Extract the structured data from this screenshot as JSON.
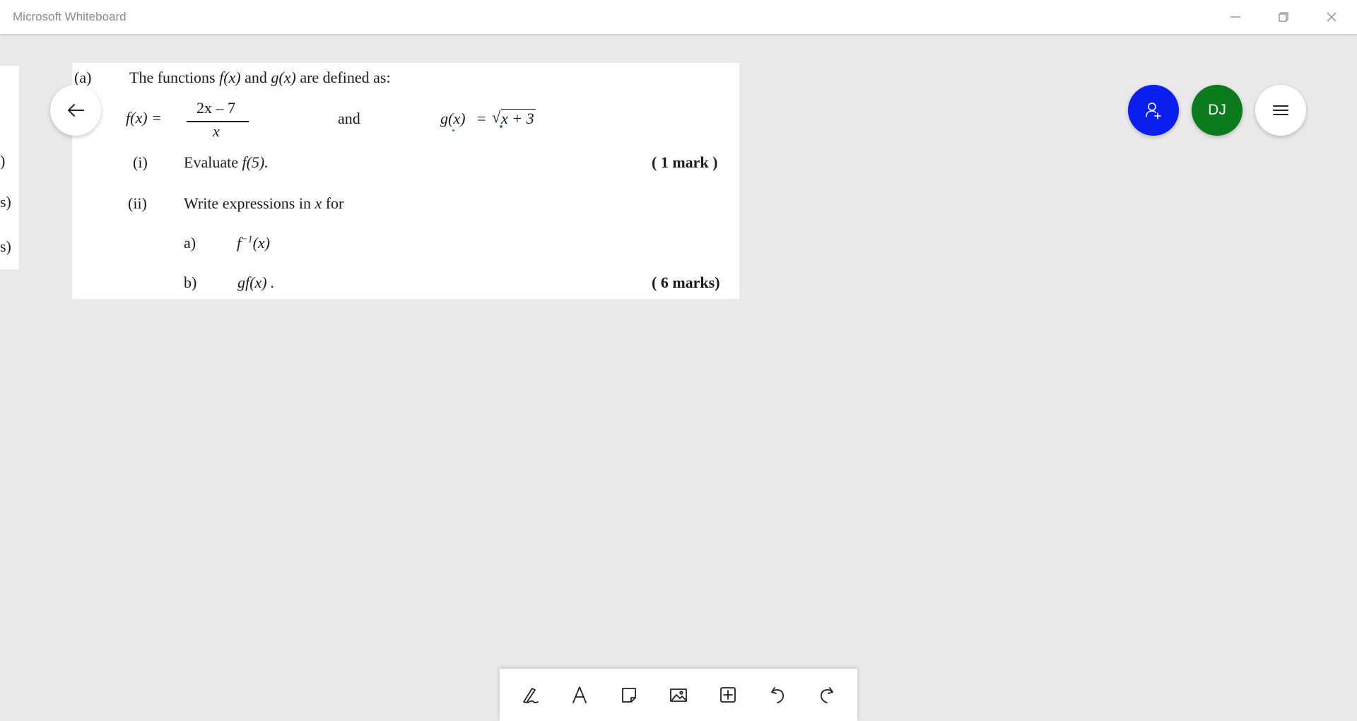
{
  "window": {
    "title": "Microsoft Whiteboard",
    "controls": [
      "minimize-icon",
      "restore-icon",
      "close-icon"
    ]
  },
  "left_card": {
    "fragments": [
      ")",
      "s)",
      "s)"
    ]
  },
  "question": {
    "part_label": "(a)",
    "intro_a": "The functions ",
    "intro_f": "f(x)",
    "intro_and": " and ",
    "intro_g": "g(x)",
    "intro_b": " are defined as:",
    "f_lhs": "f(x) =",
    "f_numerator": "2x – 7",
    "f_denominator": "x",
    "and_word": "and",
    "g_lhs": "g(x)",
    "g_equals": "=",
    "g_radical": "√",
    "g_radicand": "x + 3",
    "sub_i_label": "(i)",
    "sub_i_text_a": "Evaluate ",
    "sub_i_text_b": "f(5).",
    "sub_i_marks": "( 1 mark )",
    "sub_ii_label": "(ii)",
    "sub_ii_text_a": "Write expressions in ",
    "sub_ii_text_b": "x",
    "sub_ii_text_c": " for",
    "item_a_label": "a)",
    "item_a_expr_a": "f",
    "item_a_expr_sup": "−1",
    "item_a_expr_b": "(x)",
    "item_b_label": "b)",
    "item_b_expr": "gf(x) .",
    "sub_ii_marks": "( 6 marks)"
  },
  "buttons": {
    "back": "arrow-left-icon",
    "invite": "add-person-icon",
    "avatar_initials": "DJ",
    "menu": "hamburger-menu-icon"
  },
  "colors": {
    "invite": "#0a1ef0",
    "avatar": "#0b7a1c",
    "canvas": "#e9e9e9"
  },
  "toolbar": {
    "tools": [
      "pen-icon",
      "text-icon",
      "sticky-note-icon",
      "image-icon",
      "add-icon",
      "undo-icon",
      "redo-icon"
    ]
  }
}
